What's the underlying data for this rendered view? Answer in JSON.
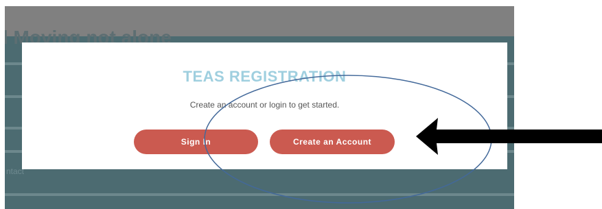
{
  "page": {
    "bg_title": "l Moving not alone",
    "bg_small_text": "ntact"
  },
  "modal": {
    "title": "TEAS REGISTRATION",
    "subtitle": "Create an account or login to get started.",
    "signin_label": "Sign In",
    "create_label": "Create an Account"
  },
  "annotations": {
    "highlight_color": "#43699a",
    "arrow_color": "#000000",
    "shapes": [
      "ellipse-highlight",
      "arrow-pointer"
    ]
  },
  "colors": {
    "title": "#9fcfdf",
    "button": "#cb5a50",
    "backdrop": "#4c6b71"
  }
}
